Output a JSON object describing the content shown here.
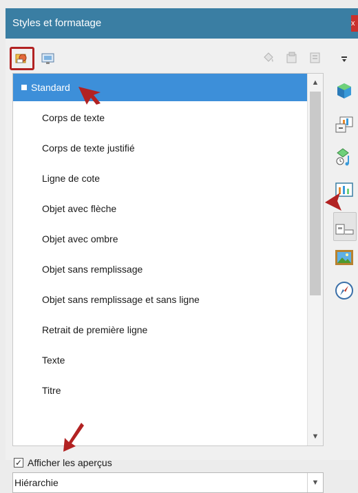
{
  "window": {
    "title": "Styles et formatage",
    "close_label": "x"
  },
  "style_list": {
    "root": "Standard",
    "items": [
      "Corps de texte",
      "Corps de texte justifié",
      "Ligne de cote",
      "Objet avec flèche",
      "Objet avec ombre",
      "Objet sans remplissage",
      "Objet sans remplissage et sans ligne",
      "Retrait de première ligne",
      "Texte",
      "Titre"
    ]
  },
  "preview": {
    "label": "Afficher les aperçus",
    "checked": true,
    "checkmark": "✓"
  },
  "filter": {
    "selected": "Hiérarchie"
  },
  "icons": {
    "toolbar_left": [
      "drawing-styles-icon",
      "presentation-styles-icon"
    ],
    "toolbar_right": [
      "fill-format-mode-icon",
      "new-style-from-selection-icon",
      "update-style-icon"
    ],
    "sidebar": [
      "sidebar-menu-icon",
      "properties-icon",
      "slide-transition-icon",
      "animation-icon",
      "master-slides-icon",
      "styles-icon",
      "gallery-icon",
      "navigator-icon"
    ]
  },
  "colors": {
    "titlebar": "#3a7ea3",
    "selection": "#3d8fd9",
    "annotation": "#b22222"
  }
}
